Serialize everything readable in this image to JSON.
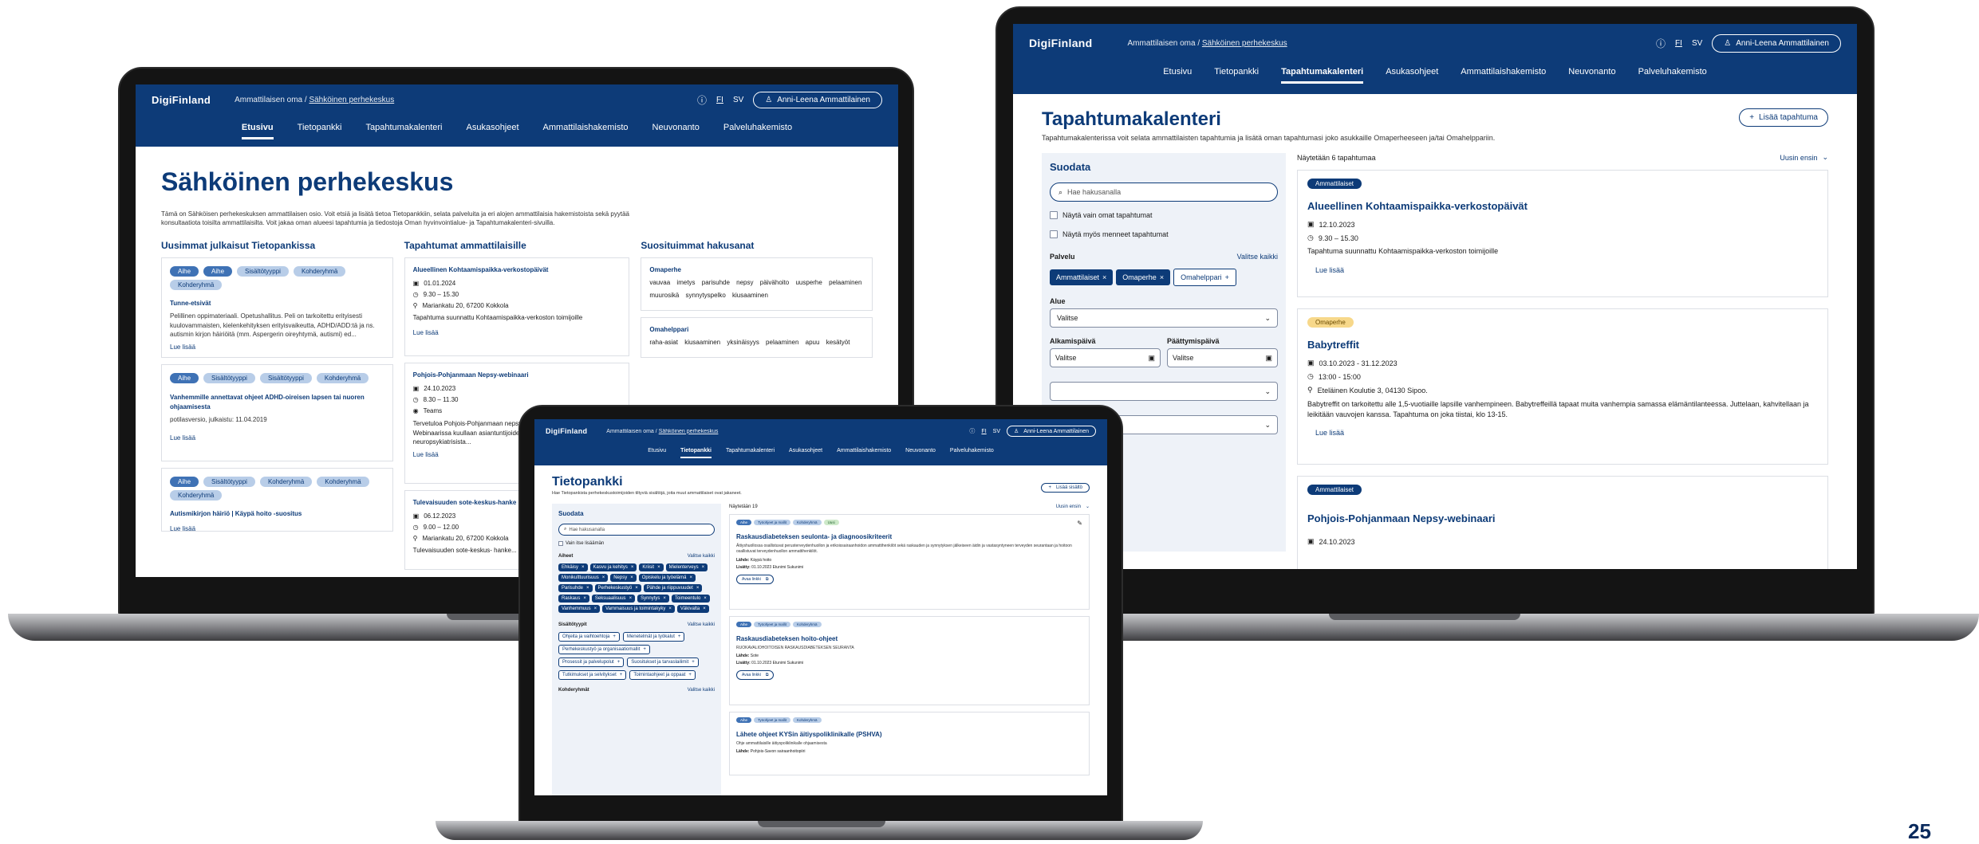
{
  "page_number": "25",
  "app": {
    "logo": "DigiFinland",
    "breadcrumb_root": "Ammattilaisen oma",
    "breadcrumb_sep": "/",
    "breadcrumb_current": "Sähköinen perhekeskus",
    "lang_fi": "FI",
    "lang_sv": "SV",
    "user": "Anni-Leena Ammattilainen",
    "nav": [
      "Etusivu",
      "Tietopankki",
      "Tapahtumakalenteri",
      "Asukasohjeet",
      "Ammattilaishakemisto",
      "Neuvonanto",
      "Palveluhakemisto"
    ]
  },
  "left": {
    "title": "Sähköinen perhekeskus",
    "intro": "Tämä on Sähköisen perhekeskuksen ammattilaisen osio. Voit etsiä ja lisätä tietoa Tietopankkiin, selata palveluita ja eri alojen ammattilaisia hakemistoista sekä pyytää konsultaatiota toisilta ammattilaisilta. Voit jakaa oman alueesi tapahtumia ja tiedostoja Oman hyvinvointialue- ja Tapahtumakalenteri-sivuilla.",
    "col1_title": "Uusimmat julkaisut Tietopankissa",
    "col2_title": "Tapahtumat ammattilaisille",
    "col3_title": "Suosituimmat hakusanat",
    "pubs": [
      {
        "tags": [
          "Aihe",
          "Aihe",
          "Sisältötyyppi",
          "Kohderyhmä",
          "Kohderyhmä"
        ],
        "title": "Tunne-etsivät",
        "text": "Pelillinen oppimateriaali. Opetushallitus. Peli on tarkoitettu erityisesti kuulovammaisten, kielenkehityksen erityisvaikeutta, ADHD/ADD:tä ja ns. autismin kirjon häiriöitä (mm. Asperger​in oireyhtymä, autismi) ed...",
        "more": "Lue lisää"
      },
      {
        "tags": [
          "Aihe",
          "Sisältötyyppi",
          "Sisältötyyppi",
          "Kohderyhmä"
        ],
        "title": "Vanhemmille annettavat ohjeet ADHD-oireisen lapsen tai nuoren ohjaamisesta",
        "text": "potilasversio, julkaistu: 11.04.2019",
        "more": "Lue lisää"
      },
      {
        "tags": [
          "Aihe",
          "Sisältötyyppi",
          "Kohderyhmä",
          "Kohderyhmä",
          "Kohderyhmä"
        ],
        "title": "Autismikirjon häiriö | Käypä hoito -suositus",
        "text": "",
        "more": "Lue lisää"
      }
    ],
    "events": [
      {
        "title": "Alueellinen Kohtaamispaikka-verkostopäivät",
        "date": "01.01.2024",
        "time": "9.30 – 15.30",
        "place": "Mariankatu 20, 67200 Kokkola",
        "text": "Tapahtuma suunnattu Kohtaamispaikka-verkoston toimijoille",
        "more": "Lue lisää"
      },
      {
        "title": "Pohjois-Pohjanmaan Nepsy-webinaari",
        "date": "24.10.2023",
        "time": "8.30 – 11.30",
        "place": "Teams",
        "text": "Tervetuloa Pohjois-Pohjanmaan nepsy-webinaariin 8.30-11.30! Webinaarissa kuullaan asiantuntijoiden ja kokemustoimijapuheenvuoroja neuropsykiatrisista...",
        "more": "Lue lisää"
      },
      {
        "title": "Tulevaisuuden sote-keskus-hanke",
        "date": "06.12.2023",
        "time": "9.00 – 12.00",
        "place": "Mariankatu 20, 67200 Kokkola",
        "text": "Tulevaisuuden sote-keskus- hanke..."
      }
    ],
    "searches": [
      {
        "title": "Omaperhe",
        "words": [
          "vauvaa",
          "imetys",
          "parisuhde",
          "nepsy",
          "päivähoito",
          "uusperhe",
          "pelaaminen",
          "muurosikä",
          "synnytyspelko",
          "kiusaaminen"
        ]
      },
      {
        "title": "Omahelppari",
        "words": [
          "raha-asiat",
          "kiusaaminen",
          "yksinäisyys",
          "pelaaminen",
          "apuu",
          "kesätyöt"
        ]
      }
    ]
  },
  "right": {
    "title": "Tapahtumakalenteri",
    "intro": "Tapahtumakalenterissa voit selata ammattilaisten tapahtumia ja lisätä oman tapahtumasi joko asukkaille Omaperheeseen ja/tai Omahelppariin.",
    "add_button": "Lisää tapahtuma",
    "filter_title": "Suodata",
    "search_placeholder": "Hae hakusanalla",
    "check1": "Näytä vain omat tapahtumat",
    "check2": "Näytä myös menneet tapahtumat",
    "service_label": "Palvelu",
    "select_all": "Valitse kaikki",
    "chips": [
      "Ammattilaiset",
      "Omaperhe"
    ],
    "chip_add": "Omahelppari",
    "area_label": "Alue",
    "select_placeholder": "Valitse",
    "start_label": "Alkamispäivä",
    "end_label": "Päättymispäivä",
    "count": "Näytetään 6 tapahtumaa",
    "sort": "Uusin ensin",
    "events": [
      {
        "tag": "Ammattilaiset",
        "tagstyle": "dk",
        "title": "Alueellinen Kohtaamispaikka-verkostopäivät",
        "date": "12.10.2023",
        "time": "9.30 – 15.30",
        "place": "",
        "text": "Tapahtuma suunnattu Kohtaamispaikka-verkoston toimijoille",
        "more": "Lue lisää"
      },
      {
        "tag": "Omaperhe",
        "tagstyle": "ye",
        "title": "Babytreffit",
        "date": "03.10.2023 - 31.12.2023",
        "time": "13:00 - 15:00",
        "place": "Eteläinen Koulutie 3, 04130 Sipoo.",
        "text": "Babytreffit on tarkoitettu alle 1,5-vuotiaille lapsille vanhempineen. Babytreffeillä tapaat muita vanhempia samassa elämäntilanteessa. Juttelaan, kahvitellaan ja leikitään vauvojen kanssa. Tapahtuma on joka tiistai, klo 13-15.",
        "more": "Lue lisää"
      },
      {
        "tag": "Ammattilaiset",
        "tagstyle": "dk",
        "title": "Pohjois-Pohjanmaan Nepsy-webinaari",
        "date": "24.10.2023",
        "time": "",
        "place": "",
        "text": "",
        "more": ""
      }
    ]
  },
  "front": {
    "title": "Tietopankki",
    "intro": "Hae Tietopankista perhekeskustoimijoiden tiltyviä sisältöjä, joita muut ammattilaiset ovat jakaneet.",
    "add_button": "Lisää sisältö",
    "filter_title": "Suodata",
    "search_placeholder": "Hae hakusanalla",
    "check1": "Vain itse lisäämän",
    "topics_label": "Aiheet",
    "select_all": "Valitse kaikki",
    "topic_chips": [
      "Ehkäisy",
      "Kasvu ja kehitys",
      "Kriisit",
      "Mielenterveys",
      "Monikulttuurisuus",
      "Nepsy",
      "Opiskelu ja työelämä",
      "Parisuhde",
      "Perhekeskustyö",
      "Pähde ja riippuvuudet",
      "Raskaus",
      "Seksuaalisuus",
      "Synnytys",
      "Toimeentulo",
      "Vanhemmuus",
      "Vammaisuus ja toimintakyky",
      "Väkivalta"
    ],
    "types_label": "Sisältötyypit",
    "type_chips": [
      "Ohjeita ja vaihtoehtoja",
      "Menetelmät ja työkalut",
      "Perhekeskustyö ja organisaatiomallit",
      "Prosessit ja palvelupolut",
      "Suositukset ja tarvaslailimit",
      "Tutkimukset ja selvitykset",
      "Toimintaohjeet ja oppaat"
    ],
    "groups_label": "Kohderyhmät",
    "count": "Näytetään 19",
    "sort": "Uusin ensin",
    "items": [
      {
        "tags": [
          "Aihe",
          "Työohjeet ja mallit",
          "Kohderyhmä",
          "Uusi"
        ],
        "title": "Raskausdiabeteksen seulonta- ja diagnoosikriteerit",
        "text": "Äitiyshuollossa osallistuvat perusterveydenhuollon ja erikoissairaanhoidon ammattihenkilöt sekä raskauden ja synnytyksen jälkeiseen äidin ja vastasyntyneen terveyden seurantaan ja hoitoon osallistuvat terveydenhuollon ammattihenkilöt.",
        "source_label": "Lähde:",
        "source": "Käypä hoito",
        "added_label": "Lisätty:",
        "added": "01.10.2023 Etunimi Sukunimi",
        "open": "Avaa linkki"
      },
      {
        "tags": [
          "Aihe",
          "Työohjeet ja mallit",
          "Kohderyhmä"
        ],
        "title": "Raskausdiabeteksen hoito-ohjeet",
        "text": "RUOKAVALIOHOITOISEN RASKAUSDIABETEKSEN SEURANTA",
        "source_label": "Lähde:",
        "source": "Sote",
        "added_label": "Lisätty:",
        "added": "01.10.2023 Etunimi Sukunimi",
        "open": "Avaa linkki"
      },
      {
        "tags": [
          "Aihe",
          "Työohjeet ja mallit",
          "Kohderyhmä"
        ],
        "title": "Lähete ohjeet KYSin äitiyspoliklinikalle (PSHVA)",
        "text": "Ohje ammattilaisille äitiyspoliklinikalle ohjaamisesta",
        "source_label": "Lähde:",
        "source": "Pohjois-Savon sairaanhoitopiiri",
        "added_label": "",
        "added": "",
        "open": ""
      }
    ]
  }
}
